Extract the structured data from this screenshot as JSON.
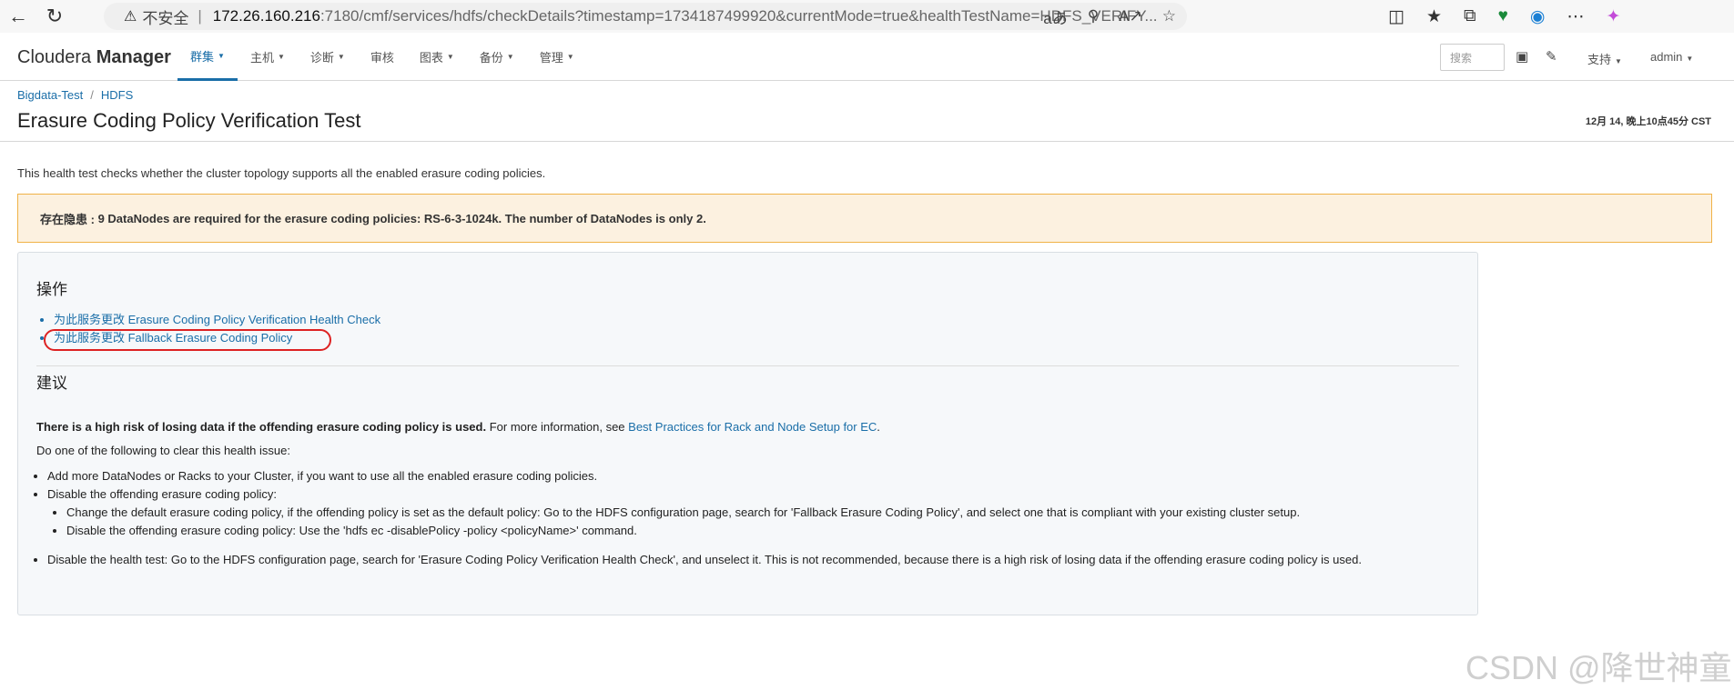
{
  "browser": {
    "insecure_label": "不安全",
    "url_host": "172.26.160.216",
    "url_path": ":7180/cmf/services/hdfs/checkDetails?timestamp=1734187499920&currentMode=true&healthTestName=HDFS_VERIFY...",
    "read_aloud": "aあ"
  },
  "app": {
    "logo_light": "Cloudera ",
    "logo_bold": "Manager",
    "nav": [
      {
        "label": "群集"
      },
      {
        "label": "主机"
      },
      {
        "label": "诊断"
      },
      {
        "label": "审核"
      },
      {
        "label": "图表"
      },
      {
        "label": "备份"
      },
      {
        "label": "管理"
      }
    ],
    "search_placeholder": "搜索",
    "support_label": "支持",
    "user_label": "admin"
  },
  "breadcrumb": {
    "cluster": "Bigdata-Test",
    "divider": "/",
    "service": "HDFS"
  },
  "page": {
    "title": "Erasure Coding Policy Verification Test",
    "timestamp": "12月 14, 晚上10点45分 CST",
    "intro": "This health test checks whether the cluster topology supports all the enabled erasure coding policies.",
    "alert_prefix": "存在隐患 : ",
    "alert_text": "9 DataNodes are required for the erasure coding policies: RS-6-3-1024k. The number of DataNodes is only 2."
  },
  "actions": {
    "heading": "操作",
    "links": [
      "为此服务更改 Erasure Coding Policy Verification Health Check",
      "为此服务更改 Fallback Erasure Coding Policy"
    ]
  },
  "recommendations": {
    "heading": "建议",
    "risk_bold": "There is a high risk of losing data if the offending erasure coding policy is used.",
    "risk_more": " For more information, see ",
    "risk_link": "Best Practices for Rack and Node Setup for EC",
    "risk_end": ".",
    "do_one": "Do one of the following to clear this health issue:",
    "item1": "Add more DataNodes or Racks to your Cluster, if you want to use all the enabled erasure coding policies.",
    "item2": "Disable the offending erasure coding policy:",
    "item2a": "Change the default erasure coding policy, if the offending policy is set as the default policy: Go to the HDFS configuration page, search for 'Fallback Erasure Coding Policy', and select one that is compliant with your existing cluster setup.",
    "item2b": "Disable the offending erasure coding policy: Use the 'hdfs ec -disablePolicy -policy <policyName>' command.",
    "item3": "Disable the health test: Go to the HDFS configuration page, search for 'Erasure Coding Policy Verification Health Check', and unselect it. This is not recommended, because there is a high risk of losing data if the offending erasure coding policy is used."
  },
  "watermark": "CSDN @降世神童"
}
